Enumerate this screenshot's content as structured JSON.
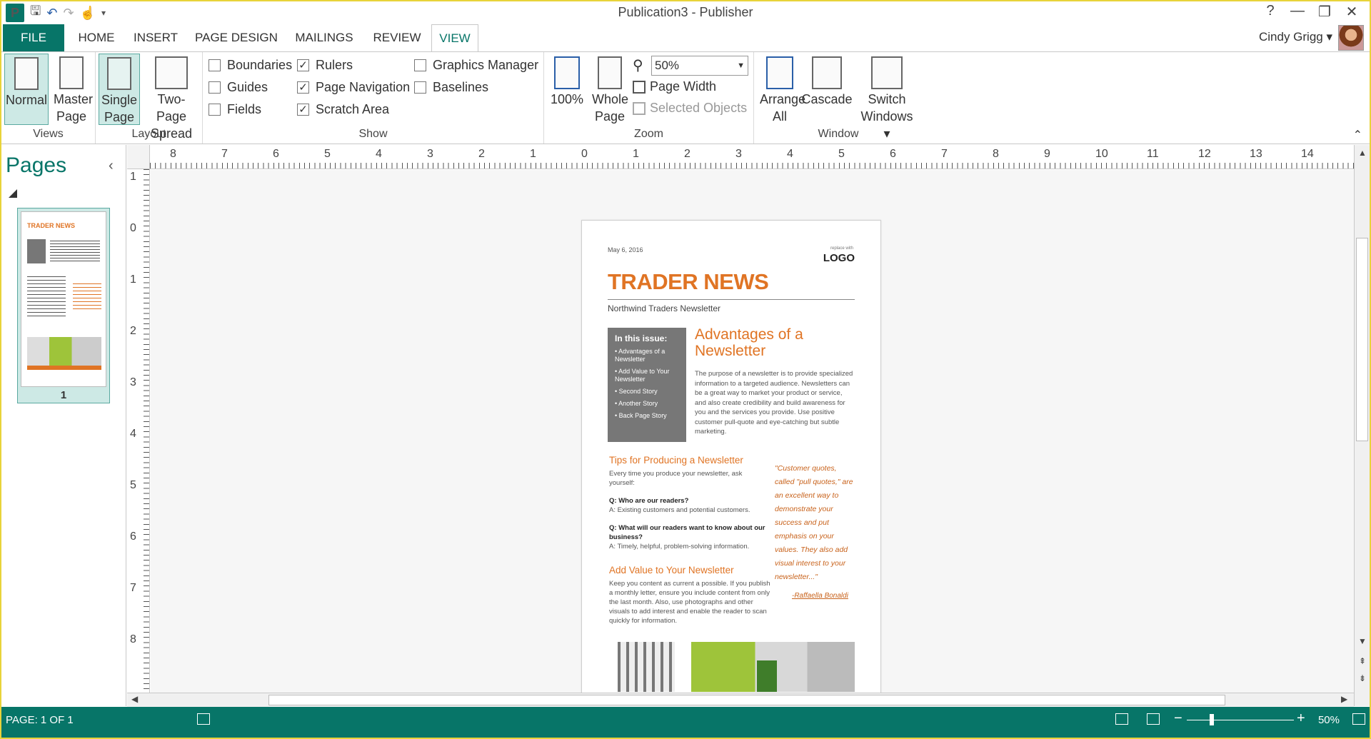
{
  "window": {
    "title": "Publication3 - Publisher",
    "controls": [
      "?",
      "—",
      "❐",
      "✕"
    ]
  },
  "qat": {
    "icons": [
      "publisher-logo",
      "save-icon",
      "undo-icon",
      "redo-icon",
      "touch-mode-icon",
      "customize-icon"
    ],
    "logo_text": "P"
  },
  "tabs": [
    "FILE",
    "HOME",
    "INSERT",
    "PAGE DESIGN",
    "MAILINGS",
    "REVIEW",
    "VIEW"
  ],
  "user": {
    "name": "Cindy Grigg ▾"
  },
  "ribbon": {
    "views": {
      "label": "Views",
      "normal": "Normal",
      "master_page": "Master Page"
    },
    "layout": {
      "label": "Layout",
      "single_page": "Single Page",
      "two_page_spread": "Two-Page Spread"
    },
    "show": {
      "label": "Show",
      "boundaries": {
        "label": "Boundaries",
        "checked": false
      },
      "guides": {
        "label": "Guides",
        "checked": false
      },
      "fields": {
        "label": "Fields",
        "checked": false
      },
      "rulers": {
        "label": "Rulers",
        "checked": true
      },
      "page_navigation": {
        "label": "Page Navigation",
        "checked": true
      },
      "scratch_area": {
        "label": "Scratch Area",
        "checked": true
      },
      "graphics_manager": {
        "label": "Graphics Manager",
        "checked": false
      },
      "baselines": {
        "label": "Baselines",
        "checked": false
      }
    },
    "zoom": {
      "label": "Zoom",
      "hundred": "100%",
      "whole_page": "Whole Page",
      "value": "50%",
      "page_width": "Page Width",
      "selected_objects": "Selected Objects"
    },
    "window": {
      "label": "Window",
      "arrange_all": "Arrange All",
      "cascade": "Cascade",
      "switch_windows": "Switch Windows ▾"
    }
  },
  "pages_pane": {
    "title": "Pages",
    "page_number": "1"
  },
  "rulers": {
    "h": [
      "8",
      "7",
      "6",
      "5",
      "4",
      "3",
      "2",
      "1",
      "0",
      "1",
      "2",
      "3",
      "4",
      "5",
      "6",
      "7",
      "8",
      "9",
      "10",
      "11",
      "12",
      "13",
      "14"
    ],
    "v": [
      "1",
      "0",
      "1",
      "2",
      "3",
      "4",
      "5",
      "6",
      "7",
      "8"
    ]
  },
  "document": {
    "date": "May 6, 2016",
    "logo_small": "replace with",
    "logo": "LOGO",
    "title": "TRADER NEWS",
    "subtitle": "Northwind Traders Newsletter",
    "sidebar_heading": "In this issue:",
    "sidebar_items": [
      "• Advantages of a Newsletter",
      "• Add Value to Your Newsletter",
      "• Second Story",
      "• Another Story",
      "• Back Page Story"
    ],
    "article1_title": "Advantages of a Newsletter",
    "article1_body": "The purpose of a newsletter is to provide specialized information to a targeted audience. Newsletters can be a great way to market your product or service, and also create credibility and build awareness for you and the services you provide. Use positive customer pull-quote and eye-catching but subtle marketing.",
    "article2_title": "Tips for Producing a Newsletter",
    "article2_intro": "Every time you produce your newsletter, ask yourself:",
    "q1": "Q: Who are our readers?",
    "a1": "A: Existing customers and potential customers.",
    "q2": "Q: What will our readers want to know about our business?",
    "a2": "A: Timely, helpful, problem-solving information.",
    "article3_title": "Add Value to Your Newsletter",
    "article3_body": "Keep you content as current a possible. If you publish a monthly letter, ensure you include content from only the last month. Also, use photographs and other visuals to add interest and enable the reader to scan quickly for information.",
    "quote": "\"Customer quotes, called \"pull quotes,\" are an excellent way to demonstrate your success and put emphasis on your values. They also add visual interest to your newsletter...\"",
    "quote_author": "-Raffaella Bonaldi"
  },
  "status": {
    "page": "PAGE: 1 OF 1",
    "zoom": "50%"
  },
  "colors": {
    "accent": "#077568",
    "orange": "#e07424"
  }
}
